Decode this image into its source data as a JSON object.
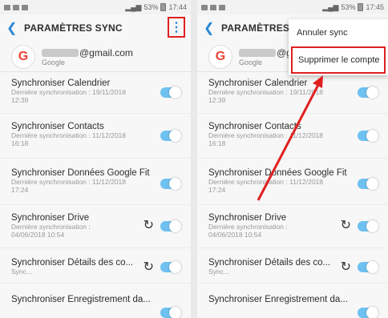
{
  "status_left": {
    "time": "17:44",
    "battery": "53%"
  },
  "status_right": {
    "time": "17:45",
    "battery": "53%"
  },
  "header": {
    "title": "PARAMÈTRES SYNC",
    "title_truncated": "PARAMÈTRES SY"
  },
  "account": {
    "email": "@gmail.com",
    "provider": "Google"
  },
  "sync_items": [
    {
      "title": "Synchroniser Calendrier",
      "sub1": "Dernière synchronisation : 19/11/2018",
      "sub2": "12:39",
      "enabled": true
    },
    {
      "title": "Synchroniser Contacts",
      "sub1": "Dernière synchronisation : 11/12/2018",
      "sub2": "16:18",
      "enabled": true
    },
    {
      "title": "Synchroniser Données Google Fit",
      "sub1": "Dernière synchronisation : 11/12/2018",
      "sub2": "17:24",
      "enabled": true
    },
    {
      "title": "Synchroniser Drive",
      "sub1": "Dernière synchronisation :",
      "sub2": "04/06/2018  10:54",
      "enabled": true
    },
    {
      "title": "Synchroniser Détails des co...",
      "sub1": "Sync...",
      "sub2": "",
      "enabled": true
    },
    {
      "title": "Synchroniser Enregistrement da...",
      "sub1": "",
      "sub2": "",
      "enabled": true
    }
  ],
  "menu": {
    "items": [
      "Annuler sync",
      "Supprimer le compte"
    ]
  },
  "colors": {
    "accent": "#2a86d6",
    "toggle_on": "#6ec1f0",
    "highlight": "#e02020"
  },
  "icons": {
    "back": "chevron-left-icon",
    "menu": "more-vert-icon",
    "sync": "sync-icon"
  }
}
